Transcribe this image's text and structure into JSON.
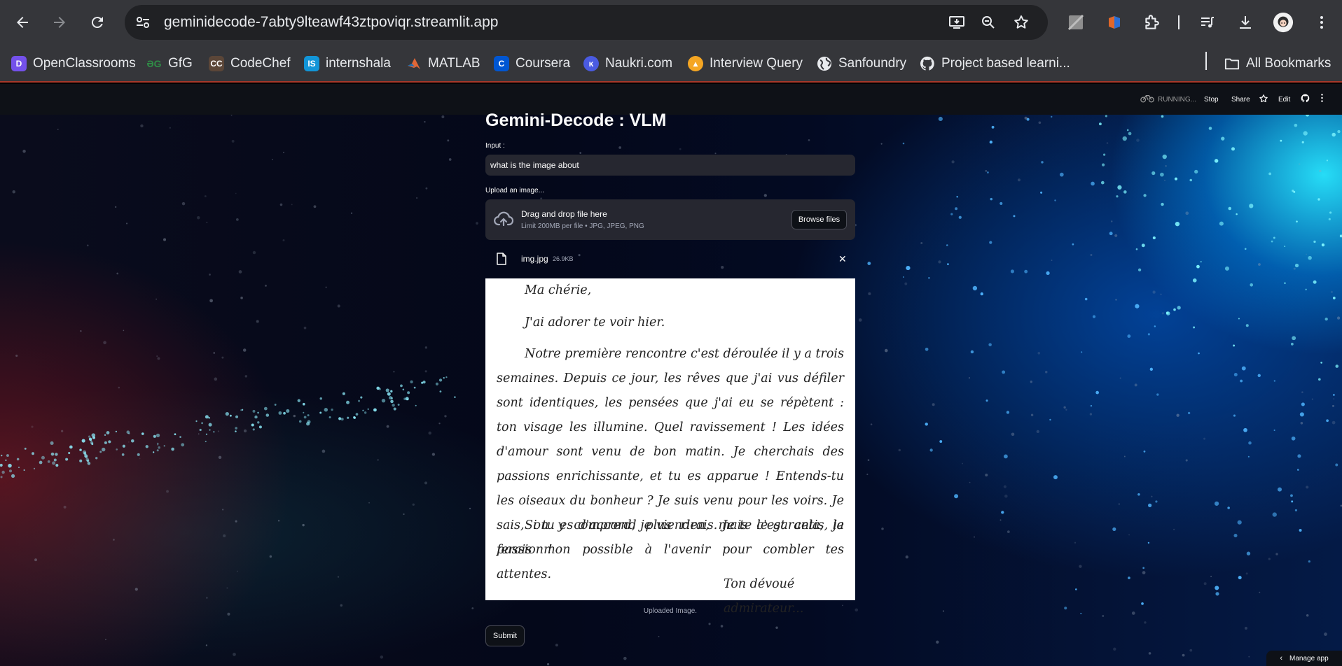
{
  "browser": {
    "url": "geminidecode-7abty9lteawf43ztpoviqr.streamlit.app",
    "bookmarks": [
      {
        "label": "OpenClassrooms",
        "icon": "openclassrooms-icon",
        "color": "#7451eb"
      },
      {
        "label": "GfG",
        "icon": "gfg-icon",
        "color": "#2f8d46"
      },
      {
        "label": "CodeChef",
        "icon": "codechef-icon",
        "color": "#5b4638"
      },
      {
        "label": "internshala",
        "icon": "internshala-icon",
        "color": "#1295d8"
      },
      {
        "label": "MATLAB",
        "icon": "matlab-icon",
        "color": "#e16737"
      },
      {
        "label": "Coursera",
        "icon": "coursera-icon",
        "color": "#0056d2"
      },
      {
        "label": "Naukri.com",
        "icon": "naukri-icon",
        "color": "#4a90e2"
      },
      {
        "label": "Interview Query",
        "icon": "interview-query-icon",
        "color": "#f5a623"
      },
      {
        "label": "Sanfoundry",
        "icon": "globe-icon",
        "color": "#e8eaed"
      },
      {
        "label": "Project based learni...",
        "icon": "github-icon",
        "color": "#e8eaed"
      }
    ],
    "all_bookmarks": "All Bookmarks"
  },
  "app_header": {
    "status": "RUNNING...",
    "stop": "Stop",
    "share": "Share",
    "edit": "Edit"
  },
  "main": {
    "title": "Gemini-Decode : VLM",
    "input_label": "Input :",
    "input_value": "what is the image about",
    "upload_label": "Upload an image...",
    "dropzone_title": "Drag and drop file here",
    "dropzone_limit": "Limit 200MB per file • JPG, JPEG, PNG",
    "browse_label": "Browse files",
    "file_name": "img.jpg",
    "file_size": "26.9KB",
    "letter": {
      "greeting": "Ma chérie,",
      "line1": "J'ai adorer te voir hier.",
      "para1": "Notre première rencontre c'est déroulée il y a trois semaines. Depuis ce jour, les rêves que j'ai vus défiler sont identiques, les pensées que j'ai eu se répètent : ton visage les illumine. Quel ravissement ! Les idées d'amour sont venu de bon matin. Je cherchais des passions enrichissante, et tu es apparue ! Entends-tu les oiseaux du bonheur ? Je suis venu pour les voirs.  Je sais, on y comprend plus rien, mais c'est cela, la passion !",
      "para2": "Si tu es d'accord, je viendrais. Je te le garantis, je ferais mon possible à l'avenir pour combler tes attentes.",
      "signature": "Ton dévoué admirateur..."
    },
    "caption": "Uploaded Image.",
    "submit_label": "Submit"
  },
  "manage_app": "Manage app"
}
